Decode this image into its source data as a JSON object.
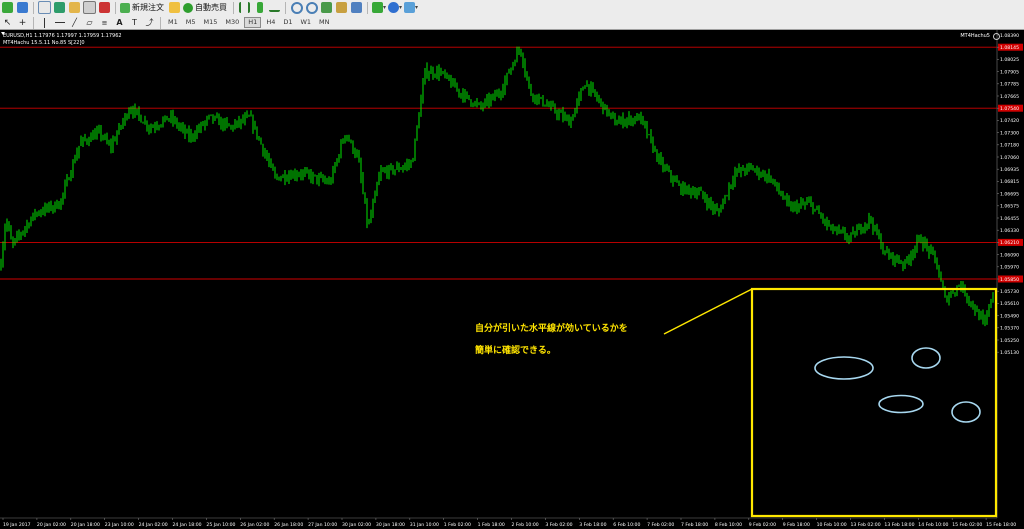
{
  "toolbar": {
    "new_order_label": "新規注文",
    "auto_trade_label": "自動売買",
    "timeframes": [
      "M1",
      "M5",
      "M15",
      "M30",
      "H1",
      "H4",
      "D1",
      "W1",
      "MN"
    ],
    "active_timeframe": "H1"
  },
  "chart": {
    "symbol_info": "EURUSD,H1  1.17976 1.17997 1.17959 1.17962",
    "ea_info": "MT4Hachu 15.5.11  No.85  S[22]0",
    "ea_name": "MT4Hachu5",
    "price_labels": [
      "1.08390",
      "1.08145",
      "1.08025",
      "1.07905",
      "1.07785",
      "1.07665",
      "1.07540",
      "1.07420",
      "1.07300",
      "1.07180",
      "1.07060",
      "1.06935",
      "1.06815",
      "1.06695",
      "1.06575",
      "1.06455",
      "1.06330",
      "1.06210",
      "1.06090",
      "1.05970",
      "1.05850",
      "1.05730",
      "1.05610",
      "1.05490",
      "1.05370",
      "1.05250",
      "1.05130"
    ],
    "highlight_prices": [
      "1.08145",
      "1.07540",
      "1.06210",
      "1.05850"
    ],
    "time_labels": [
      "19 Jan 2017",
      "20 Jan 02:00",
      "20 Jan 18:00",
      "23 Jan 10:00",
      "24 Jan 02:00",
      "24 Jan 18:00",
      "25 Jan 10:00",
      "26 Jan 02:00",
      "26 Jan 18:00",
      "27 Jan 10:00",
      "30 Jan 02:00",
      "30 Jan 18:00",
      "31 Jan 10:00",
      "1 Feb 02:00",
      "1 Feb 18:00",
      "2 Feb 10:00",
      "3 Feb 02:00",
      "3 Feb 18:00",
      "6 Feb 10:00",
      "7 Feb 02:00",
      "7 Feb 18:00",
      "8 Feb 10:00",
      "9 Feb 02:00",
      "9 Feb 18:00",
      "10 Feb 10:00",
      "13 Feb 02:00",
      "13 Feb 18:00",
      "14 Feb 10:00",
      "15 Feb 02:00",
      "15 Feb 18:00"
    ],
    "annotation": {
      "line1": "自分が引いた水平線が効いているかを",
      "line2": "簡単に確認できる。"
    },
    "colors": {
      "background": "#000000",
      "bull": "#00ff00",
      "bear": "#00ff00",
      "hline": "#d00000",
      "highlight_box": "#ffe800",
      "ellipse": "#a8d8f0",
      "label_bg": "#d00000"
    }
  }
}
